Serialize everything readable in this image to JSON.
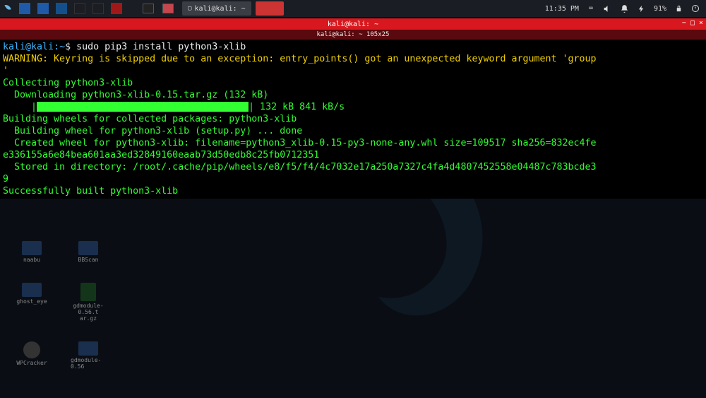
{
  "taskbar": {
    "clock": "11:35 PM",
    "battery": "91%",
    "window_title": "kali@kali: ~"
  },
  "terminal": {
    "title_top": "kali@kali: ~",
    "title_sub": "kali@kali: ~ 105x25",
    "prompt_user": "kali@kali",
    "prompt_sep": ":",
    "prompt_path": "~",
    "prompt_dollar": "$",
    "command": "sudo pip3 install python3-xlib",
    "lines": {
      "warn1": "WARNING: Keyring is skipped due to an exception: entry_points() got an unexpected keyword argument 'group",
      "warn2": "'",
      "l1": "Collecting python3-xlib",
      "l2": "  Downloading python3-xlib-0.15.tar.gz (132 kB)",
      "l3_left": "     |",
      "l3_right": "| 132 kB 841 kB/s",
      "l4": "Building wheels for collected packages: python3-xlib",
      "l5": "  Building wheel for python3-xlib (setup.py) ... done",
      "l6": "  Created wheel for python3-xlib: filename=python3_xlib-0.15-py3-none-any.whl size=109517 sha256=832ec4fe",
      "l7": "e336155a6e84bea601aa3ed32849160eaab73d50edb8c25fb0712351",
      "l8": "  Stored in directory: /root/.cache/pip/wheels/e8/f5/f4/4c7032e17a250a7327c4fa4d4807452558e04487c783bcde3",
      "l9": "9",
      "l10": "Successfully built python3-xlib"
    }
  },
  "desktop": {
    "i1": "naabu",
    "i2": "BBScan",
    "i3": "ghost_eye",
    "i4": "gdmodule-0.56.t\nar.gz",
    "i5": "WPCracker",
    "i6": "gdmodule-0.56"
  }
}
